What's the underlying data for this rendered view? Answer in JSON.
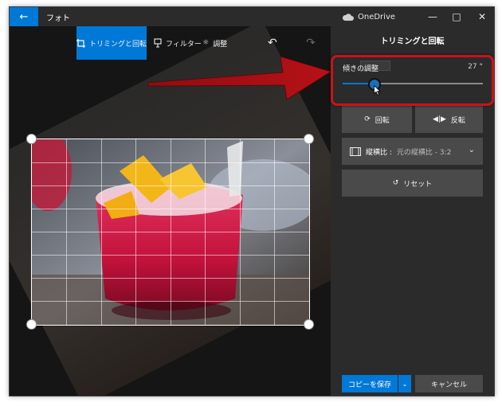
{
  "window": {
    "app_title": "フォト",
    "onedrive_label": "OneDrive"
  },
  "toolbar": {
    "crop_rotate": "トリミングと回転",
    "filters": "フィルター",
    "adjust": "調整"
  },
  "panel": {
    "title": "トリミングと回転",
    "straighten_label": "傾きの調整",
    "straighten_value": "27 °",
    "straighten_fraction": 0.23,
    "rotate_label": "回転",
    "flip_label": "反転",
    "aspect_label": "縦横比 :",
    "aspect_value": "元の縦横比 - 3:2",
    "reset_label": "リセット",
    "save_label": "コピーを保存",
    "cancel_label": "キャンセル"
  },
  "colors": {
    "accent": "#0078d7",
    "highlight": "#c81419",
    "background": "#2b2b2b"
  },
  "icons": [
    "back-arrow-icon",
    "onedrive-cloud-icon",
    "minimize-icon",
    "maximize-icon",
    "close-icon",
    "crop-icon",
    "filter-icon",
    "adjust-sun-icon",
    "undo-icon",
    "redo-icon",
    "rotate-icon",
    "flip-icon",
    "aspect-ratio-icon",
    "chevron-down-icon",
    "reset-icon",
    "mouse-cursor-icon"
  ]
}
